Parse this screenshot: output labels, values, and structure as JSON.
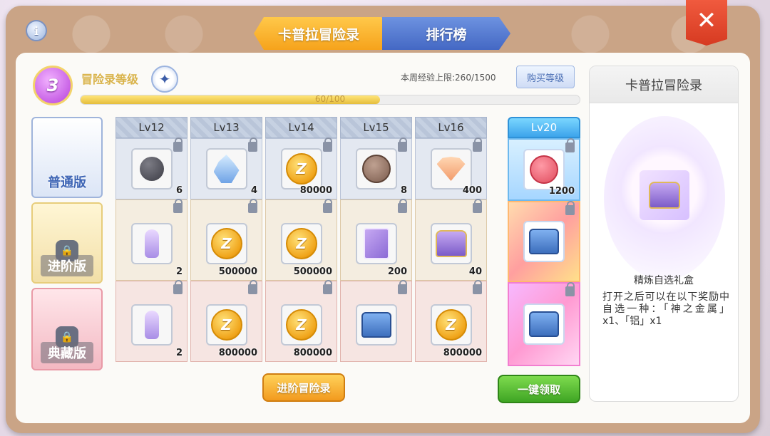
{
  "tabs": {
    "adventure": "卡普拉冒险录",
    "ranking": "排行榜"
  },
  "header": {
    "level": "3",
    "level_title": "冒险录等级",
    "exp_limit": "本周经验上限:260/1500",
    "buy_level": "购买等级",
    "progress_text": "60/100",
    "progress": 0.6
  },
  "columns": [
    {
      "label": "Lv12",
      "items": [
        {
          "icon": "stone-icon",
          "count": "6"
        },
        {
          "icon": "potion-icon",
          "count": "2"
        },
        {
          "icon": "potion-icon",
          "count": "2"
        }
      ]
    },
    {
      "label": "Lv13",
      "items": [
        {
          "icon": "crystal-icon",
          "count": "4"
        },
        {
          "icon": "zeny-coin-icon",
          "count": "500000"
        },
        {
          "icon": "zeny-coin-icon",
          "count": "800000"
        }
      ]
    },
    {
      "label": "Lv14",
      "items": [
        {
          "icon": "zeny-coin-icon",
          "count": "80000"
        },
        {
          "icon": "zeny-coin-icon",
          "count": "500000"
        },
        {
          "icon": "zeny-coin-icon",
          "count": "800000"
        }
      ]
    },
    {
      "label": "Lv15",
      "items": [
        {
          "icon": "bronze-medal-icon",
          "count": "8"
        },
        {
          "icon": "card-icon",
          "count": "200"
        },
        {
          "icon": "blue-chest-icon",
          "count": ""
        }
      ]
    },
    {
      "label": "Lv16",
      "items": [
        {
          "icon": "shell-icon",
          "count": "400"
        },
        {
          "icon": "purple-chest-icon",
          "count": "40"
        },
        {
          "icon": "zeny-coin-icon",
          "count": "800000"
        }
      ]
    }
  ],
  "lv20": {
    "label": "Lv20",
    "items": [
      {
        "icon": "pink-medal-icon",
        "count": "1200"
      },
      {
        "icon": "blue-chest-icon",
        "count": ""
      },
      {
        "icon": "blue-chest-icon",
        "count": ""
      }
    ]
  },
  "tiers": {
    "normal": "普通版",
    "advanced": "进阶版",
    "collector": "典藏版"
  },
  "buttons": {
    "advanced": "进阶冒险录",
    "claim_all": "一键领取"
  },
  "side": {
    "title": "卡普拉冒险录",
    "item_name": "精炼自选礼盒",
    "description": "打开之后可以在以下奖励中自选一种：「神之金属」x1、「铝」x1"
  },
  "colors": {
    "accent": "#f6a31c",
    "tab_blue": "#4468c4",
    "close_red": "#d63a21",
    "claim_green": "#3fa524"
  }
}
